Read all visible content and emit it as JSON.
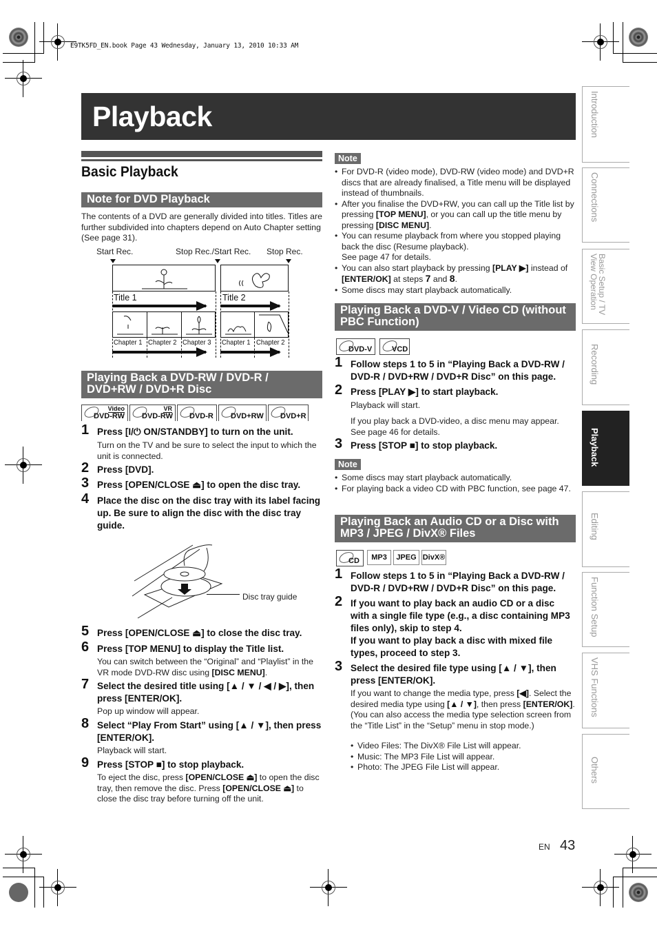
{
  "print_header": "E9TK5FD_EN.book  Page 43  Wednesday, January 13, 2010  10:33 AM",
  "chapter_title": "Playback",
  "side_tabs": [
    {
      "label": "Introduction",
      "active": false
    },
    {
      "label": "Connections",
      "active": false
    },
    {
      "label": "Basic Setup / TV View Operation",
      "active": false
    },
    {
      "label": "Recording",
      "active": false
    },
    {
      "label": "Playback",
      "active": true
    },
    {
      "label": "Editing",
      "active": false
    },
    {
      "label": "Function Setup",
      "active": false
    },
    {
      "label": "VHS Functions",
      "active": false
    },
    {
      "label": "Others",
      "active": false
    }
  ],
  "section_title": "Basic Playback",
  "note_dvd": {
    "heading": "Note for DVD Playback",
    "text": "The contents of a DVD are generally divided into titles. Titles are further subdivided into chapters depend on Auto Chapter setting (See page 31).",
    "diagram": {
      "markers": [
        "Start Rec.",
        "Stop Rec./Start Rec.",
        "Stop Rec."
      ],
      "titles": [
        "Title 1",
        "Title 2"
      ],
      "title1_chapters": [
        "Chapter 1",
        "Chapter 2",
        "Chapter 3"
      ],
      "title2_chapters": [
        "Chapter 1",
        "Chapter 2"
      ]
    }
  },
  "dvdrw": {
    "heading": "Playing Back a DVD-RW / DVD-R / DVD+RW / DVD+R Disc",
    "logos": [
      {
        "top": "Video",
        "label": "DVD-RW"
      },
      {
        "top": "VR",
        "label": "DVD-RW"
      },
      {
        "top": "",
        "label": "DVD-R"
      },
      {
        "top": "",
        "label": "DVD+RW"
      },
      {
        "top": "",
        "label": "DVD+R"
      }
    ],
    "steps": [
      {
        "num": "1",
        "text": "Press [I/⏻ ON/STANDBY] to turn on the unit.",
        "sub": "Turn on the TV and be sure to select the input to which the unit is connected."
      },
      {
        "num": "2",
        "text": "Press [DVD].",
        "sub": ""
      },
      {
        "num": "3",
        "text": "Press [OPEN/CLOSE ⏏] to open the disc tray.",
        "sub": ""
      },
      {
        "num": "4",
        "text": "Place the disc on the disc tray with its label facing up. Be sure to align the disc with the disc tray guide.",
        "sub": ""
      },
      {
        "num": "5",
        "text": "Press [OPEN/CLOSE ⏏] to close the disc tray.",
        "sub": ""
      },
      {
        "num": "6",
        "text": "Press [TOP MENU] to display the Title list.",
        "sub_pre": "You can switch between the “Original” and “Playlist” in the VR mode DVD-RW disc using ",
        "sub_key": "[DISC MENU]",
        "sub_post": "."
      },
      {
        "num": "7",
        "text": "Select the desired title using [▲ / ▼ / ◀ / ▶], then press [ENTER/OK].",
        "sub": "Pop up window will appear."
      },
      {
        "num": "8",
        "text": "Select “Play From Start” using [▲ / ▼], then press [ENTER/OK].",
        "sub": "Playback will start."
      },
      {
        "num": "9",
        "text": "Press [STOP ■] to stop playback.",
        "sub_a": "To eject the disc, press ",
        "sub_k1": "[OPEN/CLOSE ⏏]",
        "sub_b": " to open the disc tray, then remove the disc. Press ",
        "sub_k2": "[OPEN/CLOSE ⏏]",
        "sub_c": " to close the disc tray before turning off the unit."
      }
    ],
    "tray_label": "Disc tray guide"
  },
  "note1": {
    "badge": "Note",
    "items": [
      {
        "a": "For DVD-R (video mode), DVD-RW (video mode) and DVD+R discs that are already finalised, a Title menu will be displayed instead of thumbnails."
      },
      {
        "a": "After you finalise the DVD+RW, you can call up the Title list by pressing ",
        "k1": "[TOP MENU]",
        "b": ", or you can call up the title menu by pressing ",
        "k2": "[DISC MENU]",
        "c": "."
      },
      {
        "a": "You can resume playback from where you stopped playing back the disc (Resume playback).",
        "line2": "See page 47 for details."
      },
      {
        "a": "You can also start playback by pressing ",
        "k1": "[PLAY ▶]",
        "b": " instead of ",
        "k2": "[ENTER/OK]",
        "c": " at steps ",
        "s1": "7",
        "d": " and ",
        "s2": "8",
        "e": "."
      },
      {
        "a": "Some discs may start playback automatically."
      }
    ]
  },
  "dvdv": {
    "heading": "Playing Back a DVD-V / Video CD (without PBC Function)",
    "logos": [
      "DVD-V",
      "VCD"
    ],
    "steps": [
      {
        "num": "1",
        "text": "Follow steps 1 to 5 in “Playing Back a DVD-RW / DVD-R / DVD+RW / DVD+R Disc” on this page."
      },
      {
        "num": "2",
        "text": "Press [PLAY ▶] to start playback.",
        "sub1": "Playback will start.",
        "sub2": "If you play back a DVD-video, a disc menu may appear. See page 46 for details."
      },
      {
        "num": "3",
        "text": "Press [STOP ■] to stop playback."
      }
    ],
    "note_badge": "Note",
    "notes": [
      "Some discs may start playback automatically.",
      "For playing back a video CD with PBC function, see page 47."
    ]
  },
  "audiocd": {
    "heading": "Playing Back an Audio CD or a Disc with MP3 / JPEG / DivX® Files",
    "logos": [
      "CD",
      "MP3",
      "JPEG",
      "DivX®"
    ],
    "steps": [
      {
        "num": "1",
        "text": "Follow steps 1 to 5 in “Playing Back a DVD-RW / DVD-R / DVD+RW / DVD+R Disc” on this page."
      },
      {
        "num": "2",
        "text": "If you want to play back an audio CD or a disc with a single file type (e.g., a disc containing MP3 files only), skip to step 4.",
        "text2": "If you want to play back a disc with mixed file types, proceed to step 3."
      },
      {
        "num": "3",
        "text": "Select the desired file type using [▲ / ▼], then press [ENTER/OK]."
      }
    ],
    "step3_sub": {
      "a": "If you want to change the media type, press ",
      "k1": "[◀]",
      "b": ". Select the desired media type using ",
      "k2": "[▲ / ▼]",
      "c": ", then press ",
      "k3": "[ENTER/OK]",
      "d": ". (You can also access the media type selection screen from the “Title List” in the “Setup” menu in stop mode.)"
    },
    "file_lists": [
      "Video Files: The DivX® File List will appear.",
      "Music: The MP3 File List will appear.",
      "Photo: The JPEG File List will appear."
    ]
  },
  "footer": {
    "lang": "EN",
    "page": "43"
  }
}
